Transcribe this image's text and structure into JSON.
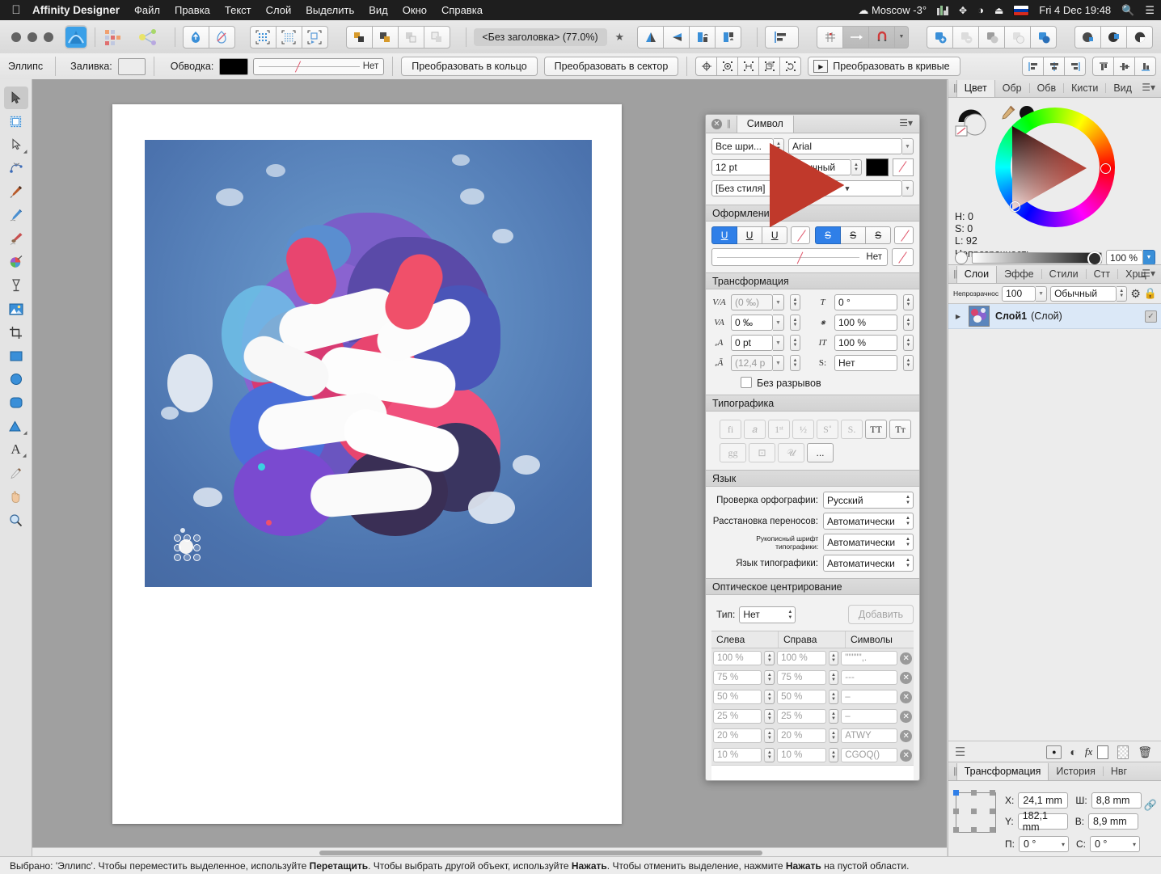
{
  "menubar": {
    "apple_icon": "apple-logo",
    "app_name": "Affinity Designer",
    "items": [
      "Файл",
      "Правка",
      "Текст",
      "Слой",
      "Выделить",
      "Вид",
      "Окно",
      "Справка"
    ],
    "status_items": {
      "weather": "Moscow -3°",
      "equalizer_icon": "audio-meter-icon",
      "bluetooth_icon": "bluetooth-icon",
      "wifi_icon": "wifi-icon",
      "eject_icon": "eject-icon",
      "flag_icon": "russian-flag-icon",
      "datetime": "Fri 4 Dec  19:48",
      "search_icon": "spotlight-search-icon",
      "controlcenter_icon": "notification-center-icon"
    }
  },
  "toolbar": {
    "traffic_lights": [
      "close",
      "minimize",
      "zoom"
    ],
    "persona_icons": [
      "designer-persona-icon",
      "pixel-persona-icon",
      "export-persona-icon"
    ],
    "doc_title": "<Без заголовка> (77.0%)",
    "star_icon": "favorite-star-icon",
    "groups": {
      "snapping_icons": [
        "snap-up-icon",
        "snap-none-icon"
      ],
      "grid_icons": [
        "show-grid-icon",
        "pixel-grid-icon",
        "snap-to-grid-icon"
      ],
      "arrange_icons": [
        "move-front-icon",
        "move-forward-icon",
        "move-backward-icon",
        "move-back-icon"
      ],
      "flip_icons": [
        "flip-horizontal-icon",
        "flip-vertical-icon",
        "rotate-left-icon",
        "rotate-right-icon"
      ],
      "align_icon": "align-left-icon",
      "grid_toggle_icon": "grid-toggle-icon",
      "snap_arrow_icon": "snap-arrow-icon",
      "magnet_icon": "magnet-snapping-icon",
      "boolean_icons": [
        "add-shape-icon",
        "subtract-shape-icon",
        "intersect-shape-icon",
        "xor-shape-icon",
        "divide-shape-icon"
      ],
      "geometry_icons": [
        "combine-icon",
        "merge-icon",
        "separate-icon"
      ]
    }
  },
  "context_bar": {
    "tool_name": "Эллипс",
    "fill_label": "Заливка:",
    "fill_color": "#ececec",
    "stroke_label": "Обводка:",
    "stroke_color": "#000000",
    "stroke_style_value": "Нет",
    "convert_to_ring": "Преобразовать в кольцо",
    "convert_to_sector": "Преобразовать в сектор",
    "convert_to_curves": "Преобразовать в кривые",
    "action_icons": [
      "center-point-icon",
      "show-bounds-icon",
      "distribute-icon",
      "duplicate-icon",
      "cycle-icon"
    ],
    "align_icons": [
      "align-left-icon",
      "align-center-h-icon",
      "align-right-icon",
      "align-top-icon",
      "align-middle-v-icon",
      "align-bottom-icon"
    ]
  },
  "tools": [
    {
      "name": "move-tool",
      "glyph": "➤",
      "selected": true
    },
    {
      "name": "artboard-tool",
      "glyph": "▣",
      "selected": false
    },
    {
      "name": "node-tool",
      "glyph": "▷",
      "selected": false
    },
    {
      "name": "corner-tool",
      "glyph": "⤳",
      "selected": false
    },
    {
      "name": "pen-tool",
      "glyph": "✒",
      "selected": false
    },
    {
      "name": "pencil-tool",
      "glyph": "✏",
      "selected": false
    },
    {
      "name": "vector-brush-tool",
      "glyph": "🖌",
      "selected": false
    },
    {
      "name": "fill-tool",
      "glyph": "🎨",
      "selected": false
    },
    {
      "name": "transparency-tool",
      "glyph": "🍸",
      "selected": false
    },
    {
      "name": "place-image-tool",
      "glyph": "🖼",
      "selected": false
    },
    {
      "name": "crop-tool",
      "glyph": "⛶",
      "selected": false
    },
    {
      "name": "rectangle-tool",
      "glyph": "▪",
      "selected": false
    },
    {
      "name": "ellipse-tool",
      "glyph": "●",
      "selected": false
    },
    {
      "name": "rounded-rectangle-tool",
      "glyph": "▢",
      "selected": false
    },
    {
      "name": "triangle-tool",
      "glyph": "▲",
      "selected": false
    },
    {
      "name": "text-tool",
      "glyph": "A",
      "selected": false
    },
    {
      "name": "color-picker-tool",
      "glyph": "💉",
      "selected": false
    },
    {
      "name": "hand-tool",
      "glyph": "✋",
      "selected": false
    },
    {
      "name": "zoom-tool",
      "glyph": "🔍",
      "selected": false
    }
  ],
  "character_panel": {
    "title": "Символ",
    "close_icon": "close-icon",
    "menu_icon": "panel-menu-icon",
    "font_family_filter": "Все шри...",
    "font_family": "Arial",
    "font_size": "12 pt",
    "font_style": "Обычный",
    "text_color": "#000000",
    "text_style": "[Без стиля]",
    "sections": {
      "decoration": {
        "title": "Оформление",
        "underline_buttons": [
          "U",
          "U",
          "U"
        ],
        "underline_active_index": 0,
        "strike_buttons": [
          "S",
          "S",
          "S"
        ],
        "strike_active_index": 0,
        "none_label": "Нет"
      },
      "transform": {
        "title": "Трансформация",
        "tracking_label_icon": "tracking-icon",
        "tracking": "(0 ‰)",
        "kerning_label_icon": "kerning-icon",
        "kerning": "0 ‰",
        "baseline_label_icon": "baseline-shift-icon",
        "baseline": "0 pt",
        "leading_label_icon": "leading-icon",
        "leading": "(12,4 p",
        "skew_label_icon": "skew-icon",
        "skew": "0 °",
        "vscale_label_icon": "vertical-scale-icon",
        "vscale": "100 %",
        "hscale_label_icon": "horizontal-scale-icon",
        "hscale": "100 %",
        "position_label": "S:",
        "position": "Нет",
        "no_break_label": "Без разрывов",
        "no_break_checked": false
      },
      "typography": {
        "title": "Типографика",
        "row1": [
          "fi",
          "𝑎",
          "1ˢᵗ",
          "½",
          "S˚",
          "S.",
          "TT",
          "Tт"
        ],
        "row1_enabled": [
          false,
          false,
          false,
          false,
          false,
          false,
          true,
          true
        ],
        "row2": [
          "gg",
          "⊡",
          "𝒰",
          "..."
        ],
        "row2_enabled": [
          false,
          false,
          false,
          true
        ]
      },
      "language": {
        "title": "Язык",
        "rows": [
          {
            "label": "Проверка орфографии:",
            "value": "Русский"
          },
          {
            "label": "Расстановка переносов:",
            "value": "Автоматически"
          },
          {
            "label": "Рукописный шрифт типографики:",
            "value": "Автоматически"
          },
          {
            "label": "Язык типографики:",
            "value": "Автоматически"
          }
        ]
      },
      "optical_alignment": {
        "title": "Оптическое центрирование",
        "type_label": "Тип:",
        "type_value": "Нет",
        "add_button": "Добавить",
        "columns": [
          "Слева",
          "Справа",
          "Символы"
        ],
        "rows": [
          {
            "left": "100 %",
            "right": "100 %",
            "chars": "\"\"\"\"\",."
          },
          {
            "left": "75 %",
            "right": "75 %",
            "chars": "---"
          },
          {
            "left": "50 %",
            "right": "50 %",
            "chars": "–"
          },
          {
            "left": "25 %",
            "right": "25 %",
            "chars": "–"
          },
          {
            "left": "20 %",
            "right": "20 %",
            "chars": "ATWY"
          },
          {
            "left": "10 %",
            "right": "10 %",
            "chars": "CGOQ()"
          }
        ],
        "delete_icon": "delete-row-icon"
      }
    }
  },
  "dock": {
    "color_tabs": [
      "Цвет",
      "Обр",
      "Обв",
      "Кисти",
      "Вид"
    ],
    "color_active_tab": "Цвет",
    "color": {
      "swap_icon": "swap-fill-stroke-icon",
      "picker_icon": "eyedropper-icon",
      "h_label": "H: 0",
      "s_label": "S: 0",
      "l_label": "L: 92",
      "opacity_label": "Непрозрачность",
      "opacity_value": "100 %",
      "wheel_hue_hex": "#c0392b"
    },
    "layer_tabs": [
      "Слои",
      "Эффе",
      "Стили",
      "Стт",
      "Хрщ"
    ],
    "layer_active_tab": "Слои",
    "layers_header": {
      "opacity_label": "Непрозрачнос",
      "opacity_value": "100",
      "blend_mode": "Обычный",
      "gear_icon": "settings-gear-icon",
      "lock_icon": "lock-icon"
    },
    "layers": [
      {
        "name": "Слой1",
        "kind": "(Слой)",
        "visible": true,
        "expand_icon": "disclosure-triangle-icon",
        "thumb_icon": "layer-thumbnail"
      }
    ],
    "layer_footer_icons": [
      "layer-stack-icon",
      "adjustment-icon",
      "mask-icon",
      "fx-icon",
      "new-layer-icon",
      "new-mask-icon",
      "delete-layer-icon"
    ],
    "fx_label": "fx",
    "transform_tabs": [
      "Трансформация",
      "История",
      "Нвг"
    ],
    "transform_active_tab": "Трансформация",
    "transform": {
      "x_label": "X:",
      "x_value": "24,1 mm",
      "y_label": "Y:",
      "y_value": "182,1 mm",
      "w_label": "Ш:",
      "w_value": "8,8 mm",
      "h_label": "В:",
      "h_value": "8,9 mm",
      "r_label": "П:",
      "r_value": "0 °",
      "s_label": "С:",
      "s_value": "0 °",
      "link_icon": "link-ratio-icon",
      "anchor_icon": "anchor-point-grid"
    }
  },
  "canvas": {
    "scrollbar_icon": "horizontal-scrollbar",
    "selection_handles_icon": "selection-handles"
  },
  "status_bar": {
    "parts": [
      {
        "t": "Выбрано: 'Эллипс'. Чтобы переместить выделенное, используйте ",
        "b": false
      },
      {
        "t": "Перетащить",
        "b": true
      },
      {
        "t": ". Чтобы выбрать другой объект, используйте ",
        "b": false
      },
      {
        "t": "Нажать",
        "b": true
      },
      {
        "t": ". Чтобы отменить выделение, нажмите ",
        "b": false
      },
      {
        "t": "Нажать",
        "b": true
      },
      {
        "t": " на пустой области.",
        "b": false
      }
    ]
  }
}
